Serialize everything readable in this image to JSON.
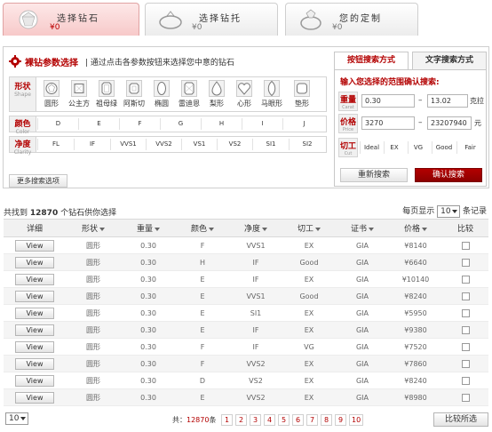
{
  "steps": [
    {
      "title": "选择钻石",
      "price": "¥0"
    },
    {
      "title": "选择钻托",
      "price": "¥0"
    },
    {
      "title": "您的定制",
      "price": "¥0"
    }
  ],
  "panel": {
    "title": "裸钻参数选择",
    "subtitle": "| 通过点击各参数按钮来选择您中意的钻石"
  },
  "shape": {
    "label": "形状",
    "label_en": "Shape",
    "items": [
      "圆形",
      "公主方",
      "祖母绿",
      "阿斯切",
      "椭圆",
      "雷迪恩",
      "梨形",
      "心形",
      "马眼形",
      "垫形"
    ]
  },
  "color": {
    "label": "颜色",
    "label_en": "Color",
    "items": [
      "D",
      "E",
      "F",
      "G",
      "H",
      "I",
      "J"
    ]
  },
  "clarity": {
    "label": "净度",
    "label_en": "Clarity",
    "items": [
      "FL",
      "IF",
      "VVS1",
      "VVS2",
      "VS1",
      "VS2",
      "SI1",
      "SI2"
    ]
  },
  "more_options": "更多搜索选项",
  "right": {
    "tabs": [
      "按钮搜索方式",
      "文字搜索方式"
    ],
    "hint": "输入您选择的范围确认搜索:",
    "weight": {
      "label": "重量",
      "label_en": "Carat",
      "min": "0.30",
      "max": "13.02",
      "unit": "克拉"
    },
    "price": {
      "label": "价格",
      "label_en": "Price",
      "min": "3270",
      "max": "23207940",
      "unit": "元"
    },
    "cut": {
      "label": "切工",
      "label_en": "Cut",
      "items": [
        "Ideal",
        "EX",
        "VG",
        "Good",
        "Fair"
      ]
    },
    "reset": "重新搜索",
    "confirm": "确认搜索",
    "dash": "–"
  },
  "results": {
    "prefix": "共找到",
    "count": "12870",
    "suffix": "个钻石供你选择",
    "perpage_label": "每页显示",
    "perpage_value": "10",
    "perpage_suffix": "条记录"
  },
  "table": {
    "headers": [
      "详细",
      "形状",
      "重量",
      "颜色",
      "净度",
      "切工",
      "证书",
      "价格",
      "比较"
    ],
    "view_label": "View",
    "rows": [
      {
        "shape": "圆形",
        "weight": "0.30",
        "color": "F",
        "clarity": "VVS1",
        "cut": "EX",
        "cert": "GIA",
        "price": "¥8140"
      },
      {
        "shape": "圆形",
        "weight": "0.30",
        "color": "H",
        "clarity": "IF",
        "cut": "Good",
        "cert": "GIA",
        "price": "¥6640"
      },
      {
        "shape": "圆形",
        "weight": "0.30",
        "color": "E",
        "clarity": "IF",
        "cut": "EX",
        "cert": "GIA",
        "price": "¥10140"
      },
      {
        "shape": "圆形",
        "weight": "0.30",
        "color": "E",
        "clarity": "VVS1",
        "cut": "Good",
        "cert": "GIA",
        "price": "¥8240"
      },
      {
        "shape": "圆形",
        "weight": "0.30",
        "color": "E",
        "clarity": "SI1",
        "cut": "EX",
        "cert": "GIA",
        "price": "¥5950"
      },
      {
        "shape": "圆形",
        "weight": "0.30",
        "color": "E",
        "clarity": "IF",
        "cut": "EX",
        "cert": "GIA",
        "price": "¥9380"
      },
      {
        "shape": "圆形",
        "weight": "0.30",
        "color": "F",
        "clarity": "IF",
        "cut": "VG",
        "cert": "GIA",
        "price": "¥7520"
      },
      {
        "shape": "圆形",
        "weight": "0.30",
        "color": "F",
        "clarity": "VVS2",
        "cut": "EX",
        "cert": "GIA",
        "price": "¥7860"
      },
      {
        "shape": "圆形",
        "weight": "0.30",
        "color": "D",
        "clarity": "VS2",
        "cut": "EX",
        "cert": "GIA",
        "price": "¥8240"
      },
      {
        "shape": "圆形",
        "weight": "0.30",
        "color": "E",
        "clarity": "VVS2",
        "cut": "EX",
        "cert": "GIA",
        "price": "¥8980"
      }
    ]
  },
  "footer": {
    "perpage_value": "10",
    "total_prefix": "共：",
    "total": "12870",
    "total_suffix": "条",
    "pages": [
      "1",
      "2",
      "3",
      "4",
      "5",
      "6",
      "7",
      "8",
      "9",
      "10"
    ],
    "compare_button": "比较所选"
  },
  "colors": {
    "brand": "#b30000",
    "active_tab": "#f7c9c9"
  }
}
